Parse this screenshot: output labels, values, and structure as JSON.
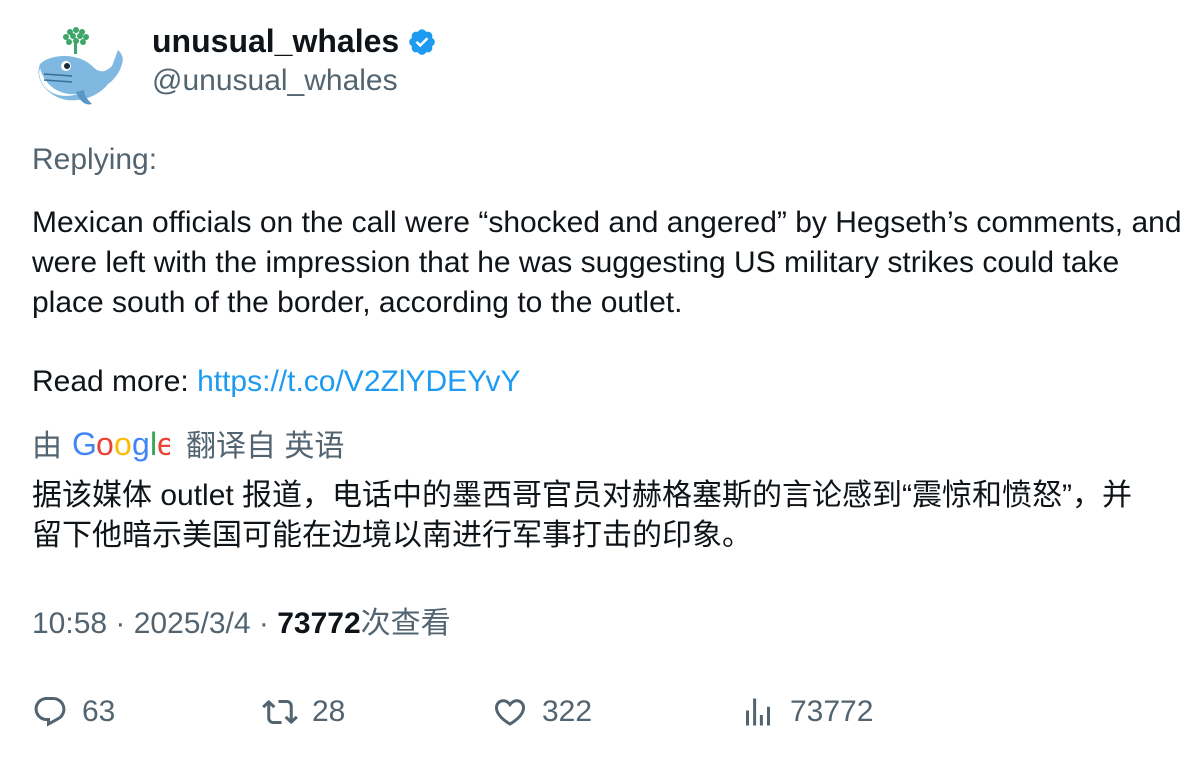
{
  "author": {
    "display_name": "unusual_whales",
    "handle": "@unusual_whales",
    "verified": true
  },
  "tweet": {
    "replying_label": "Replying:",
    "text": "Mexican officials on the call were “shocked and angered” by Hegseth’s comments, and were left with the impression that he was suggesting US military strikes could take place south of the border, according to the outlet.",
    "read_more_label": "Read more: ",
    "link": "https://t.co/V2ZlYDEYvY"
  },
  "translation": {
    "prefix": "由",
    "provider": "Google",
    "suffix": "翻译自 英语",
    "text": "据该媒体 outlet 报道，电话中的墨西哥官员对赫格塞斯的言论感到“震惊和愤怒”，并留下他暗示美国可能在边境以南进行军事打击的印象。"
  },
  "meta": {
    "time": "10:58",
    "separator": " · ",
    "date": "2025/3/4",
    "views": "73772",
    "views_label": "次查看"
  },
  "actions": {
    "replies": "63",
    "retweets": "28",
    "likes": "322",
    "views": "73772"
  },
  "colors": {
    "link": "#1d9bf0",
    "secondary_text": "#536471",
    "verified": "#1d9bf0"
  }
}
